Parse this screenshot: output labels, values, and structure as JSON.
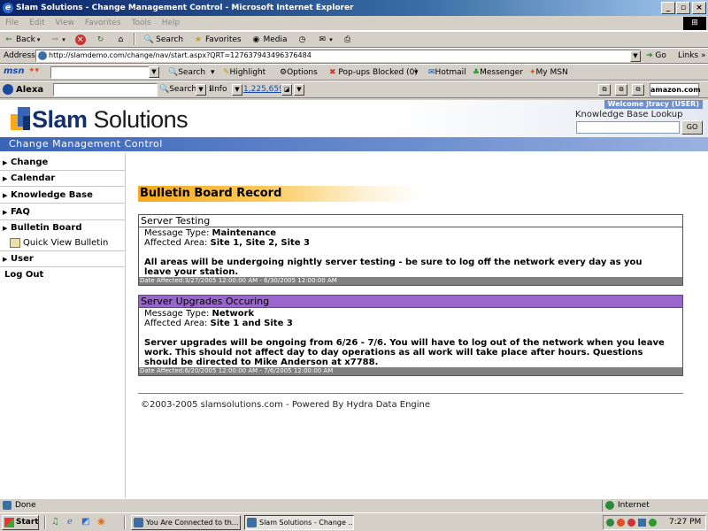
{
  "window": {
    "title": "Slam Solutions - Change Management Control - Microsoft Internet Explorer"
  },
  "menu": [
    "File",
    "Edit",
    "View",
    "Favorites",
    "Tools",
    "Help"
  ],
  "toolbar": {
    "back": "Back",
    "search": "Search",
    "favorites": "Favorites",
    "media": "Media"
  },
  "address": {
    "label": "Address",
    "url": "http://slamdemo.com/change/nav/start.aspx?QRT=127637943496376484",
    "go": "Go",
    "links": "Links"
  },
  "msnbar": {
    "logo": "msn",
    "search": "Search",
    "highlight": "Highlight",
    "options": "Options",
    "popups": "Pop-ups Blocked (0)",
    "hotmail": "Hotmail",
    "messenger": "Messenger",
    "mymsn": "My MSN"
  },
  "alexabar": {
    "logo": "Alexa",
    "search": "Search",
    "info": "Info",
    "rank": "1,225,659",
    "amazon": "amazon.com"
  },
  "site": {
    "brand_bold": "Slam",
    "brand_rest": " Solutions",
    "subtitle": "Change Management Control",
    "welcome": "Welcome jtracy (USER)",
    "kb_label": "Knowledge Base Lookup",
    "kb_go": "GO"
  },
  "sidebar": [
    {
      "label": "Change"
    },
    {
      "label": "Calendar"
    },
    {
      "label": "Knowledge Base"
    },
    {
      "label": "FAQ"
    },
    {
      "label": "Bulletin Board"
    },
    {
      "label": "Quick View Bulletin"
    },
    {
      "label": "User"
    },
    {
      "label": "Log Out"
    }
  ],
  "main": {
    "heading": "Bulletin Board Record",
    "bulletins": [
      {
        "title": "Server Testing",
        "type_label": "Message Type: ",
        "type": "Maintenance",
        "area_label": "Affected Area: ",
        "area": "Site 1, Site 2, Site 3",
        "message": "All areas will be undergoing nightly server testing - be sure to log off the network every day as you leave your station.",
        "date": "Date Affected:3/27/2005 12:00:00 AM - 6/30/2005 12:00:00 AM",
        "color": "#ffffff"
      },
      {
        "title": "Server Upgrades Occuring",
        "type_label": "Message Type: ",
        "type": "Network",
        "area_label": "Affected Area: ",
        "area": "Site 1 and Site 3",
        "message": "Server upgrades will be ongoing from 6/26 - 7/6. You will have to log out of the network when you leave work. This should not affect day to day operations as all work will take place after hours. Questions should be directed to Mike Anderson at x7788.",
        "date": "Date Affected:6/20/2005 12:00:00 AM - 7/6/2005 12:00:00 AM",
        "color": "#9966cc"
      }
    ],
    "copyright": "©2003-2005 slamsolutions.com - Powered By Hydra Data Engine"
  },
  "statusbar": {
    "text": "Done",
    "zone": "Internet"
  },
  "taskbar": {
    "start": "Start",
    "tasks": [
      "You Are Connected to th...",
      "Slam Solutions - Change ..."
    ],
    "clock": "7:27 PM"
  }
}
